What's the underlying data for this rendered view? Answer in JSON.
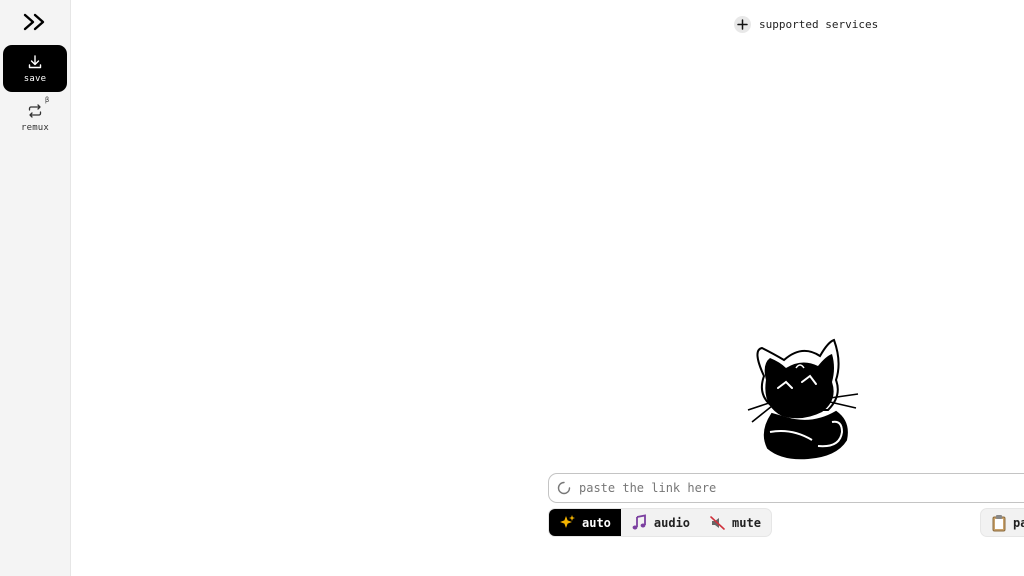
{
  "sidebar": {
    "logo_icon": "double-chevron-right-icon",
    "items": [
      {
        "label": "save",
        "icon": "download-icon",
        "active": true
      },
      {
        "label": "remux",
        "icon": "repeat-icon",
        "badge": "β"
      }
    ]
  },
  "header": {
    "services_label": "supported services",
    "services_icon": "plus-icon"
  },
  "omnibox": {
    "placeholder": "paste the link here",
    "icon": "spinner-icon"
  },
  "modes": [
    {
      "label": "auto",
      "icon": "sparkles-icon",
      "active": true
    },
    {
      "label": "audio",
      "icon": "music-notes-icon",
      "active": false
    },
    {
      "label": "mute",
      "icon": "muted-icon",
      "active": false
    }
  ],
  "paste_button": {
    "label": "pa",
    "icon": "clipboard-icon"
  },
  "colors": {
    "accent": "#000000",
    "sidebar_bg": "#f4f4f4",
    "audio_icon": "#7b3fa0",
    "auto_icon": "#f5b400"
  }
}
